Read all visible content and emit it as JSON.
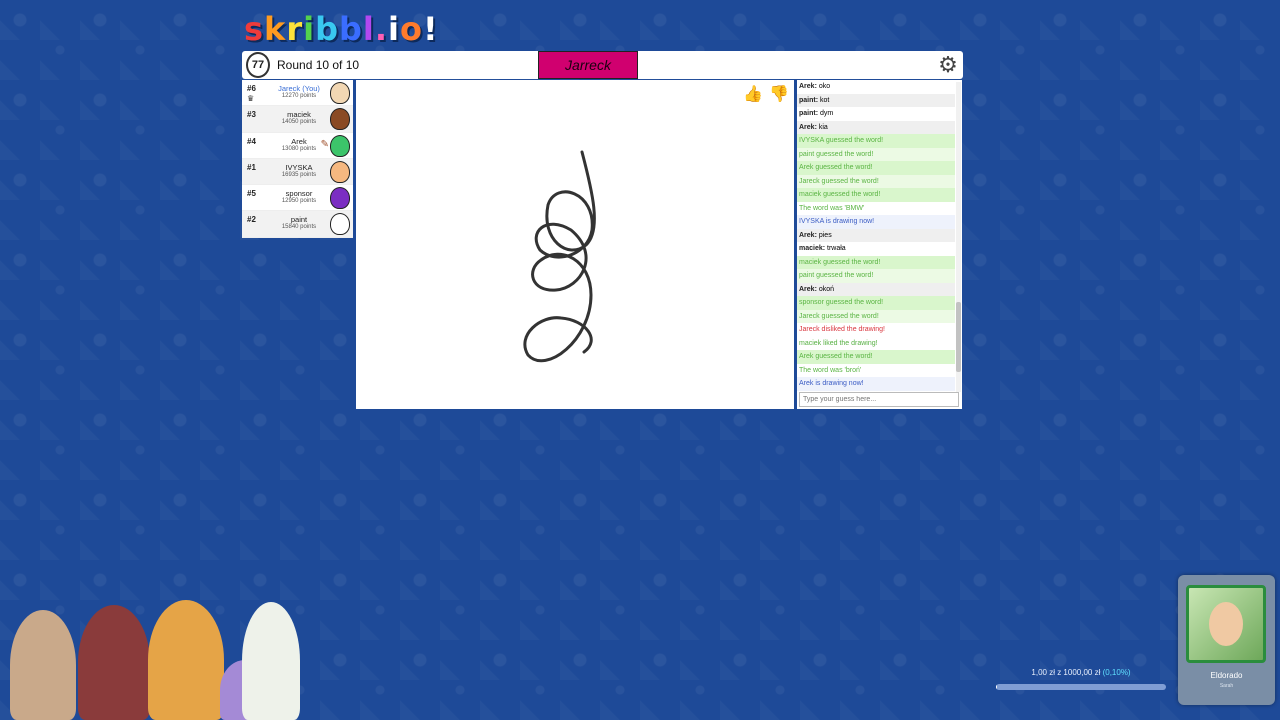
{
  "logo": "skribbl.io",
  "topbar": {
    "timer": "77",
    "round_text": "Round 10 of 10",
    "word_display": "Jarreck"
  },
  "players": [
    {
      "rank": "#6",
      "name": "Jareck (You)",
      "points": "12270 points",
      "you": true,
      "crown": true,
      "avatar_color": "#f2d7b3"
    },
    {
      "rank": "#3",
      "name": "maciek",
      "points": "14050 points",
      "avatar_color": "#8a4a24"
    },
    {
      "rank": "#4",
      "name": "Arek",
      "points": "13080 points",
      "drawing": true,
      "avatar_color": "#3cc46a"
    },
    {
      "rank": "#1",
      "name": "IVYSKA",
      "points": "16935 points",
      "avatar_color": "#f6b880"
    },
    {
      "rank": "#5",
      "name": "sponsor",
      "points": "12950 points",
      "avatar_color": "#7b2ec2"
    },
    {
      "rank": "#2",
      "name": "paint",
      "points": "15840 points",
      "avatar_color": "#ffffff"
    }
  ],
  "chat": {
    "messages": [
      {
        "type": "plain",
        "author": "Arek:",
        "text": "oko"
      },
      {
        "type": "plain",
        "author": "paint:",
        "text": "kot"
      },
      {
        "type": "plain",
        "author": "paint:",
        "text": "dym"
      },
      {
        "type": "plain",
        "author": "Arek:",
        "text": "kia"
      },
      {
        "type": "guess",
        "text": "IVYSKA guessed the word!"
      },
      {
        "type": "guess alt",
        "text": "paint guessed the word!"
      },
      {
        "type": "guess",
        "text": "Arek guessed the word!"
      },
      {
        "type": "guess alt",
        "text": "Jareck guessed the word!"
      },
      {
        "type": "guess",
        "text": "maciek guessed the word!"
      },
      {
        "type": "word",
        "text": "The word was 'BMW'"
      },
      {
        "type": "drawing",
        "text": "IVYSKA is drawing now!"
      },
      {
        "type": "plain",
        "author": "Arek:",
        "text": "pies"
      },
      {
        "type": "plain",
        "author": "maciek:",
        "text": "trwała"
      },
      {
        "type": "guess",
        "text": "maciek guessed the word!"
      },
      {
        "type": "guess alt",
        "text": "paint guessed the word!"
      },
      {
        "type": "plain",
        "author": "Arek:",
        "text": "okoń"
      },
      {
        "type": "guess",
        "text": "sponsor guessed the word!"
      },
      {
        "type": "guess alt",
        "text": "Jareck guessed the word!"
      },
      {
        "type": "disliked",
        "text": "Jareck disliked the drawing!"
      },
      {
        "type": "liked",
        "text": "maciek liked the drawing!"
      },
      {
        "type": "guess",
        "text": "Arek guessed the word!"
      },
      {
        "type": "word",
        "text": "The word was 'broń'"
      },
      {
        "type": "drawing",
        "text": "Arek is drawing now!"
      }
    ],
    "input_placeholder": "Type your guess here..."
  },
  "like_buttons": {
    "up_icon": "thumbs-up-icon",
    "down_icon": "thumbs-down-icon"
  },
  "donation": {
    "text": "1,00 zł z 1000,00 zł",
    "percent_text": "(0,10%)",
    "progress": 0.001
  },
  "music": {
    "title": "Eldorado",
    "artist": "Sarah"
  }
}
